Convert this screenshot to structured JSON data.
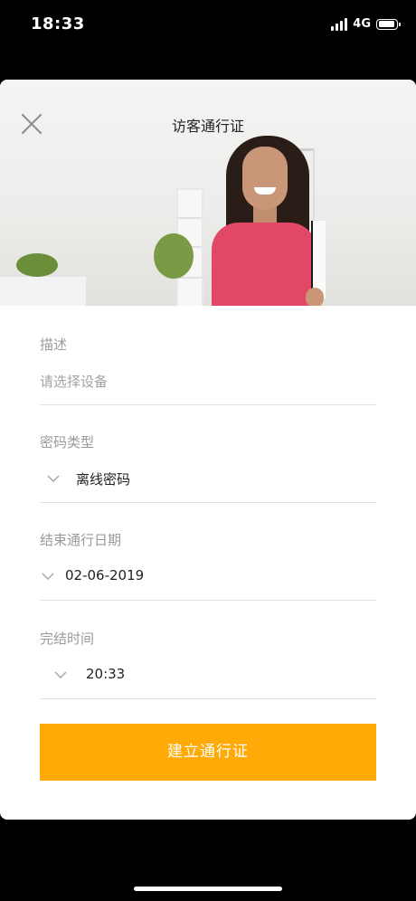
{
  "status_bar": {
    "time": "18:33",
    "network": "4G"
  },
  "header": {
    "title": "访客通行证"
  },
  "form": {
    "description": {
      "label": "描述",
      "placeholder": "请选择设备"
    },
    "password_type": {
      "label": "密码类型",
      "value": "离线密码"
    },
    "end_date": {
      "label": "结束通行日期",
      "value": "02-06-2019"
    },
    "end_time": {
      "label": "完结时间",
      "value": "20:33"
    }
  },
  "submit": {
    "label": "建立通行证"
  },
  "colors": {
    "accent": "#ffaa06",
    "background": "#000000",
    "card": "#ffffff"
  },
  "icons": [
    "close-icon",
    "chevron-down-icon",
    "signal-icon",
    "battery-icon"
  ]
}
